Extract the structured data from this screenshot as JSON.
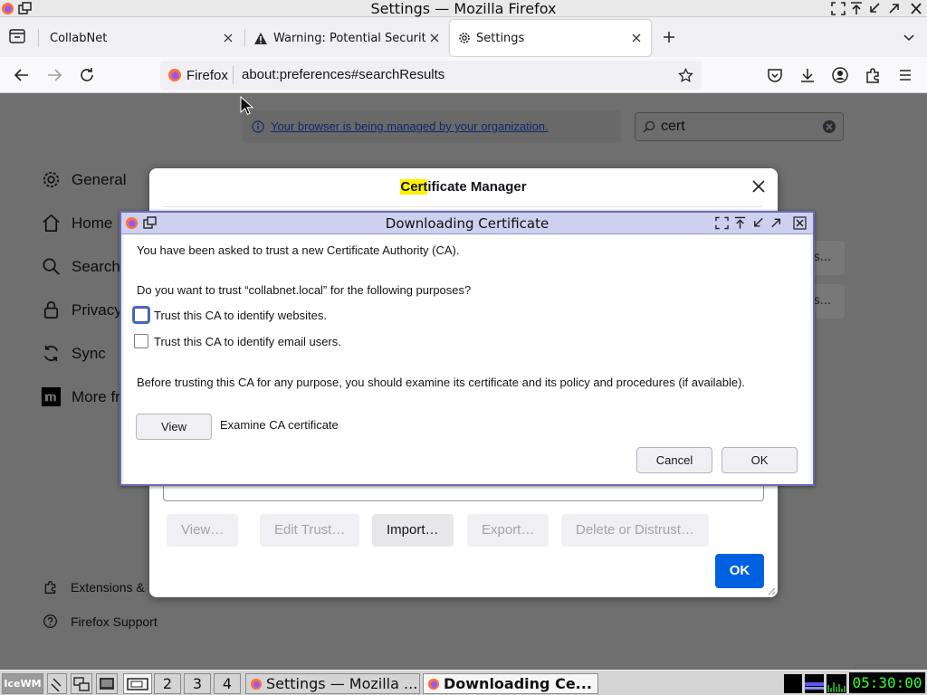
{
  "window": {
    "title": "Settings — Mozilla Firefox"
  },
  "tabs": [
    {
      "label": "CollabNet"
    },
    {
      "label": "Warning: Potential Security"
    },
    {
      "label": "Settings"
    }
  ],
  "navbar": {
    "identity_label": "Firefox",
    "url": "about:preferences#searchResults"
  },
  "settings": {
    "policy_notice": "Your browser is being managed by your organization.",
    "search_value": "cert",
    "nav": [
      {
        "label": "General",
        "icon": "gear-icon"
      },
      {
        "label": "Home",
        "icon": "home-icon"
      },
      {
        "label": "Search",
        "icon": "search-icon"
      },
      {
        "label": "Privacy",
        "icon": "lock-icon"
      },
      {
        "label": "Sync",
        "icon": "sync-icon"
      },
      {
        "label": "More fr",
        "icon": "mozilla-icon"
      }
    ],
    "footer_links": [
      {
        "label": "Extensions &",
        "icon": "extension-icon"
      },
      {
        "label": "Firefox Support",
        "icon": "help-icon"
      }
    ],
    "ghost_rows": [
      "s...",
      "s..."
    ]
  },
  "cert_manager": {
    "title_highlight": "Cert",
    "title_rest": "ificate Manager",
    "buttons": {
      "view": "View…",
      "edit_trust": "Edit Trust…",
      "import": "Import…",
      "export": "Export…",
      "delete": "Delete or Distrust…",
      "ok": "OK"
    }
  },
  "download_dialog": {
    "title": "Downloading Certificate",
    "intro": "You have been asked to trust a new Certificate Authority (CA).",
    "question": "Do you want to trust “collabnet.local” for the following purposes?",
    "checkboxes": [
      {
        "label": "Trust this CA to identify websites.",
        "checked": false
      },
      {
        "label": "Trust this CA to identify email users.",
        "checked": false
      }
    ],
    "advice": "Before trusting this CA for any purpose, you should examine its certificate and its policy and procedures (if available).",
    "view_button": "View",
    "examine_label": "Examine CA certificate",
    "cancel_button": "Cancel",
    "ok_button": "OK"
  },
  "taskbar": {
    "workspaces": [
      "2",
      "3",
      "4"
    ],
    "tasks": [
      {
        "label": "Settings — Mozilla ...",
        "active": false
      },
      {
        "label": "Downloading Ce...",
        "active": true
      }
    ],
    "clock": "05:30:00"
  },
  "colors": {
    "accent": "#0061e0",
    "dialog_titlebar": "#cdd0ee",
    "highlight": "#fff200",
    "clock_fg": "#33ff33"
  }
}
